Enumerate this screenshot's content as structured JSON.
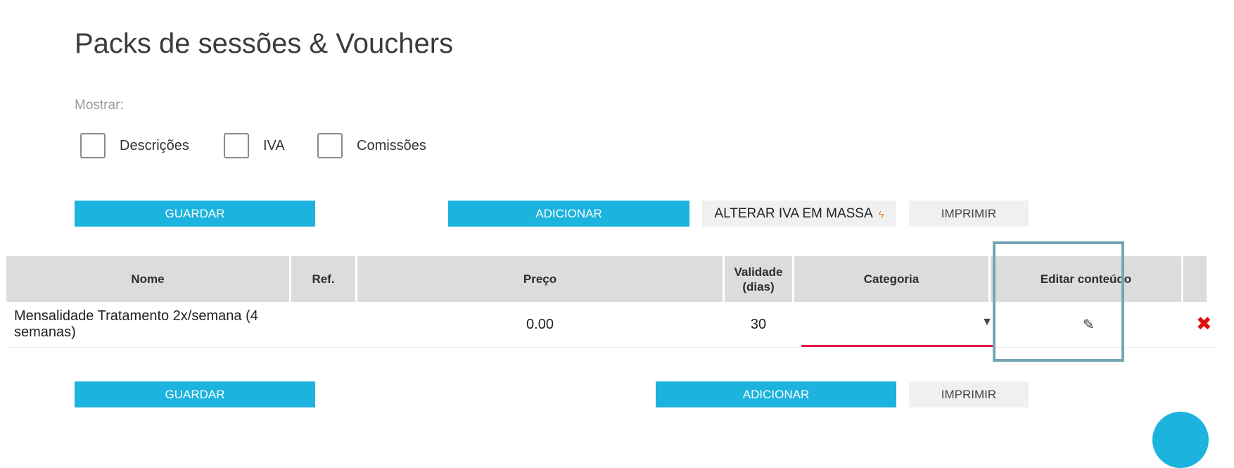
{
  "page": {
    "title": "Packs de sessões & Vouchers"
  },
  "filters": {
    "label": "Mostrar:",
    "options": [
      {
        "label": "Descrições",
        "checked": false
      },
      {
        "label": "IVA",
        "checked": false
      },
      {
        "label": "Comissões",
        "checked": false
      }
    ]
  },
  "toolbar_top": {
    "save_label": "GUARDAR",
    "add_label": "ADICIONAR",
    "bulk_vat_label": "ALTERAR IVA EM MASSA",
    "bulk_vat_icon": "lightning-icon",
    "print_label": "IMPRIMIR"
  },
  "table": {
    "headers": {
      "name": "Nome",
      "ref": "Ref.",
      "price": "Preço",
      "validity": "Validade (dias)",
      "category": "Categoria",
      "edit_content": "Editar conteúdo"
    },
    "rows": [
      {
        "name": "Mensalidade Tratamento 2x/semana (4 semanas)",
        "ref": "",
        "price": "0.00",
        "validity": "30",
        "category": "",
        "edit_icon": "pencil-icon",
        "delete_icon": "close-icon"
      }
    ]
  },
  "toolbar_bottom": {
    "save_label": "GUARDAR",
    "add_label": "ADICIONAR",
    "print_label": "IMPRIMIR"
  },
  "colors": {
    "primary": "#1cb3de",
    "secondary_button": "#f0f0f0",
    "header_bg": "#dcdcdc",
    "category_underline": "#e31b4f",
    "delete": "#e01010",
    "highlight_border": "#73a5b3"
  }
}
